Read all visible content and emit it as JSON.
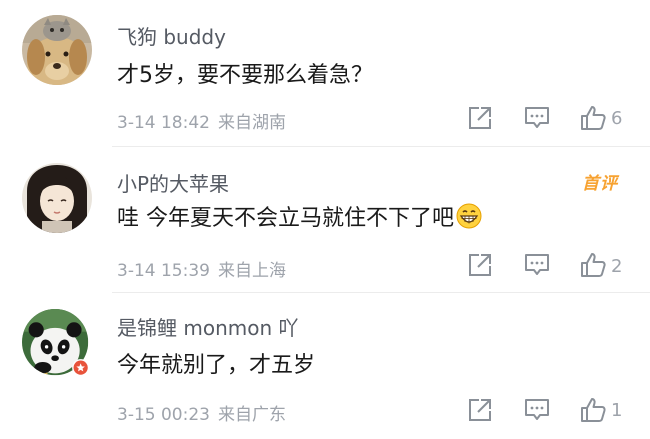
{
  "comments": [
    {
      "username": "飞狗 buddy",
      "text": "才5岁，要不要那么着急？",
      "date": "3-14 18:42",
      "location": "来自湖南",
      "likes": "6",
      "avatar_icon": "dog-avatar"
    },
    {
      "username": "小P的大苹果",
      "text": "哇 今年夏天不会立马就住不下了吧",
      "date": "3-14 15:39",
      "location": "来自上海",
      "likes": "2",
      "badge": "首评",
      "avatar_icon": "anime-girl-avatar",
      "emoji_icon": "grin-emoji-icon"
    },
    {
      "username": "是锦鲤 monmon 吖",
      "text": "今年就别了，才五岁",
      "date": "3-15 00:23",
      "location": "来自广东",
      "likes": "1",
      "avatar_icon": "panda-avatar"
    }
  ],
  "icons": {
    "share": "share-icon",
    "reply": "comment-icon",
    "like": "thumbs-up-icon"
  },
  "colors": {
    "username": "#555a63",
    "meta": "#9ea3ab",
    "badge": "#f7a231",
    "text": "#1a1a1a"
  }
}
